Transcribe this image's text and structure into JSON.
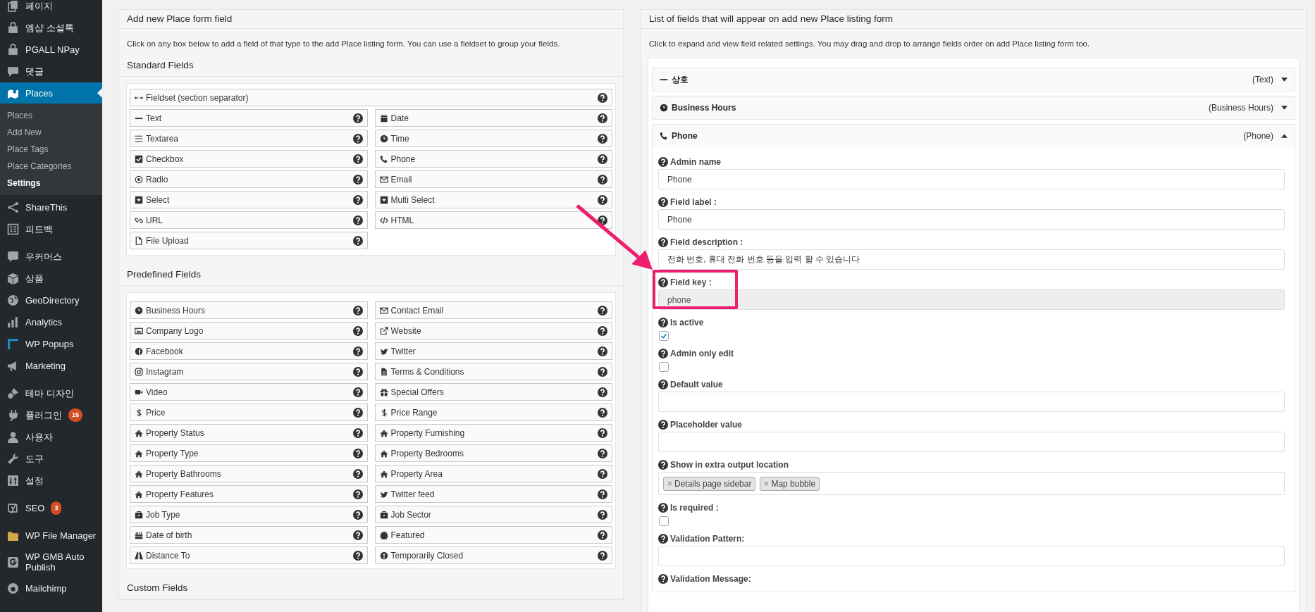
{
  "sidebar": {
    "groups": [
      [
        {
          "label": "페이지",
          "kind": "pages",
          "selected": false
        },
        {
          "label": "엠샵 소셜톡",
          "kind": "bag",
          "selected": false
        },
        {
          "label": "PGALL NPay",
          "kind": "bag",
          "selected": false
        },
        {
          "label": "댓글",
          "kind": "comment",
          "selected": false
        },
        {
          "label": "Places",
          "kind": "map",
          "selected": true,
          "children": [
            {
              "label": "Places",
              "selected": false
            },
            {
              "label": "Add New",
              "selected": false
            },
            {
              "label": "Place Tags",
              "selected": false
            },
            {
              "label": "Place Categories",
              "selected": false
            },
            {
              "label": "Settings",
              "selected": true
            }
          ]
        },
        {
          "label": "ShareThis",
          "kind": "share",
          "selected": false
        },
        {
          "label": "피드백",
          "kind": "form",
          "selected": false
        }
      ],
      [
        {
          "label": "우커머스",
          "kind": "bubble",
          "selected": false
        },
        {
          "label": "상품",
          "kind": "cube",
          "selected": false
        },
        {
          "label": "GeoDirectory",
          "kind": "globe",
          "selected": false
        },
        {
          "label": "Analytics",
          "kind": "bars",
          "selected": false
        },
        {
          "label": "WP Popups",
          "kind": "frame",
          "selected": false
        },
        {
          "label": "Marketing",
          "kind": "megaphone",
          "selected": false
        }
      ],
      [
        {
          "label": "테마 디자인",
          "kind": "brush",
          "selected": false
        },
        {
          "label": "플러그인",
          "kind": "plug",
          "selected": false,
          "badge": "15"
        },
        {
          "label": "사용자",
          "kind": "user",
          "selected": false
        },
        {
          "label": "도구",
          "kind": "wrench",
          "selected": false
        },
        {
          "label": "설정",
          "kind": "sliders",
          "selected": false
        }
      ],
      [
        {
          "label": "SEO",
          "kind": "logo",
          "selected": false,
          "badge": "3"
        }
      ],
      [
        {
          "label": "WP File Manager",
          "kind": "folder",
          "selected": false
        },
        {
          "label": "WP GMB Auto Publish",
          "kind": "glogo",
          "selected": false
        },
        {
          "label": "Mailchimp",
          "kind": "round",
          "selected": false
        }
      ]
    ]
  },
  "add_panel": {
    "title": "Add new Place form field",
    "description": "Click on any box below to add a field of that type to the add Place listing form. You can use a fieldset to group your fields.",
    "sections": [
      {
        "heading": "Standard Fields",
        "wide_fields": [
          {
            "label": "Fieldset (section separator)",
            "kind": "arrows"
          }
        ],
        "fields": [
          {
            "label": "Text",
            "kind": "dash"
          },
          {
            "label": "Date",
            "kind": "calendar"
          },
          {
            "label": "Textarea",
            "kind": "lines"
          },
          {
            "label": "Time",
            "kind": "clock"
          },
          {
            "label": "Checkbox",
            "kind": "checkbox"
          },
          {
            "label": "Phone",
            "kind": "phone"
          },
          {
            "label": "Radio",
            "kind": "radio"
          },
          {
            "label": "Email",
            "kind": "envelope"
          },
          {
            "label": "Select",
            "kind": "dropdown"
          },
          {
            "label": "Multi Select",
            "kind": "dropdown"
          },
          {
            "label": "URL",
            "kind": "link"
          },
          {
            "label": "HTML",
            "kind": "code"
          },
          {
            "label": "File Upload",
            "kind": "file"
          }
        ]
      },
      {
        "heading": "Predefined Fields",
        "fields": [
          {
            "label": "Business Hours",
            "kind": "clock"
          },
          {
            "label": "Contact Email",
            "kind": "envelope"
          },
          {
            "label": "Company Logo",
            "kind": "image"
          },
          {
            "label": "Website",
            "kind": "external"
          },
          {
            "label": "Facebook",
            "kind": "fcircle"
          },
          {
            "label": "Twitter",
            "kind": "bird"
          },
          {
            "label": "Instagram",
            "kind": "camera"
          },
          {
            "label": "Terms & Conditions",
            "kind": "document"
          },
          {
            "label": "Video",
            "kind": "video"
          },
          {
            "label": "Special Offers",
            "kind": "gift"
          },
          {
            "label": "Price",
            "kind": "dollar"
          },
          {
            "label": "Price Range",
            "kind": "dollar"
          },
          {
            "label": "Property Status",
            "kind": "house"
          },
          {
            "label": "Property Furnishing",
            "kind": "house"
          },
          {
            "label": "Property Type",
            "kind": "house"
          },
          {
            "label": "Property Bedrooms",
            "kind": "house"
          },
          {
            "label": "Property Bathrooms",
            "kind": "house"
          },
          {
            "label": "Property Area",
            "kind": "house"
          },
          {
            "label": "Property Features",
            "kind": "house"
          },
          {
            "label": "Twitter feed",
            "kind": "bird"
          },
          {
            "label": "Job Type",
            "kind": "briefcase"
          },
          {
            "label": "Job Sector",
            "kind": "briefcase"
          },
          {
            "label": "Date of birth",
            "kind": "cake"
          },
          {
            "label": "Featured",
            "kind": "starburst"
          },
          {
            "label": "Distance To",
            "kind": "road"
          },
          {
            "label": "Temporarily Closed",
            "kind": "exclamation"
          }
        ]
      },
      {
        "heading": "Custom Fields"
      }
    ]
  },
  "list_panel": {
    "title": "List of fields that will appear on add new Place listing form",
    "description": "Click to expand and view field related settings. You may drag and drop to arrange fields order on add Place listing form too.",
    "items": [
      {
        "label": "상호",
        "kind": "dash",
        "type_label": "(Text)",
        "expanded": false
      },
      {
        "label": "Business Hours",
        "kind": "clock",
        "type_label": "(Business Hours)",
        "expanded": false
      },
      {
        "label": "Phone",
        "kind": "phone",
        "type_label": "(Phone)",
        "expanded": true,
        "settings": [
          {
            "kind": "text",
            "label": "Admin name",
            "value": "Phone",
            "disabled": false,
            "highlighted": false
          },
          {
            "kind": "text",
            "label": "Field label :",
            "value": "Phone",
            "disabled": false,
            "highlighted": false
          },
          {
            "kind": "text",
            "label": "Field description :",
            "value": "전화 번호, 휴대 전화 번호 등을 입력 할 수 있습니다",
            "disabled": false,
            "highlighted": false
          },
          {
            "kind": "text",
            "label": "Field key :",
            "value": "phone",
            "disabled": true,
            "highlighted": true
          },
          {
            "kind": "checkbox",
            "label": "Is active",
            "checked": true,
            "highlighted": false
          },
          {
            "kind": "checkbox",
            "label": "Admin only edit",
            "checked": false,
            "highlighted": false
          },
          {
            "kind": "text",
            "label": "Default value",
            "disabled": false,
            "highlighted": false
          },
          {
            "kind": "text",
            "label": "Placeholder value",
            "disabled": false,
            "highlighted": false
          },
          {
            "kind": "tags",
            "label": "Show in extra output location",
            "tags": [
              "Details page sidebar",
              "Map bubble"
            ],
            "highlighted": false
          },
          {
            "kind": "checkbox",
            "label": "Is required :",
            "checked": false,
            "highlighted": false
          },
          {
            "kind": "text",
            "label": "Validation Pattern:",
            "disabled": false,
            "highlighted": false
          },
          {
            "kind": "label",
            "label": "Validation Message:",
            "highlighted": false
          }
        ]
      }
    ]
  }
}
